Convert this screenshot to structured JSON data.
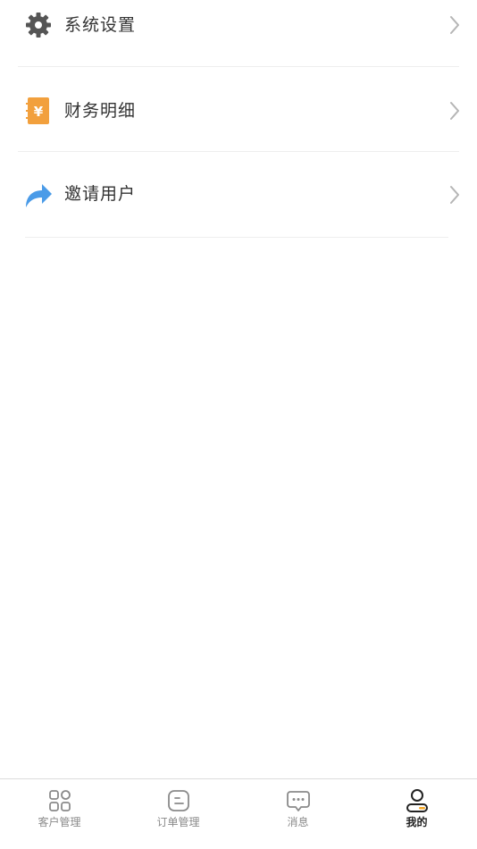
{
  "menu": {
    "items": [
      {
        "label": "系统设置",
        "icon": "gear-icon"
      },
      {
        "label": "财务明细",
        "icon": "finance-icon"
      },
      {
        "label": "邀请用户",
        "icon": "share-arrow-icon"
      }
    ]
  },
  "tabbar": {
    "tabs": [
      {
        "label": "客户管理",
        "icon": "grid-icon",
        "active": false
      },
      {
        "label": "订单管理",
        "icon": "order-icon",
        "active": false
      },
      {
        "label": "消息",
        "icon": "message-icon",
        "active": false
      },
      {
        "label": "我的",
        "icon": "profile-icon",
        "active": true
      }
    ]
  },
  "colors": {
    "finance_orange": "#F2A03D",
    "share_blue": "#4A9BE8",
    "gear_gray": "#555555",
    "inactive_tab": "#8A8A8A",
    "active_tab": "#222222",
    "active_tab_accent": "#F5A623"
  }
}
